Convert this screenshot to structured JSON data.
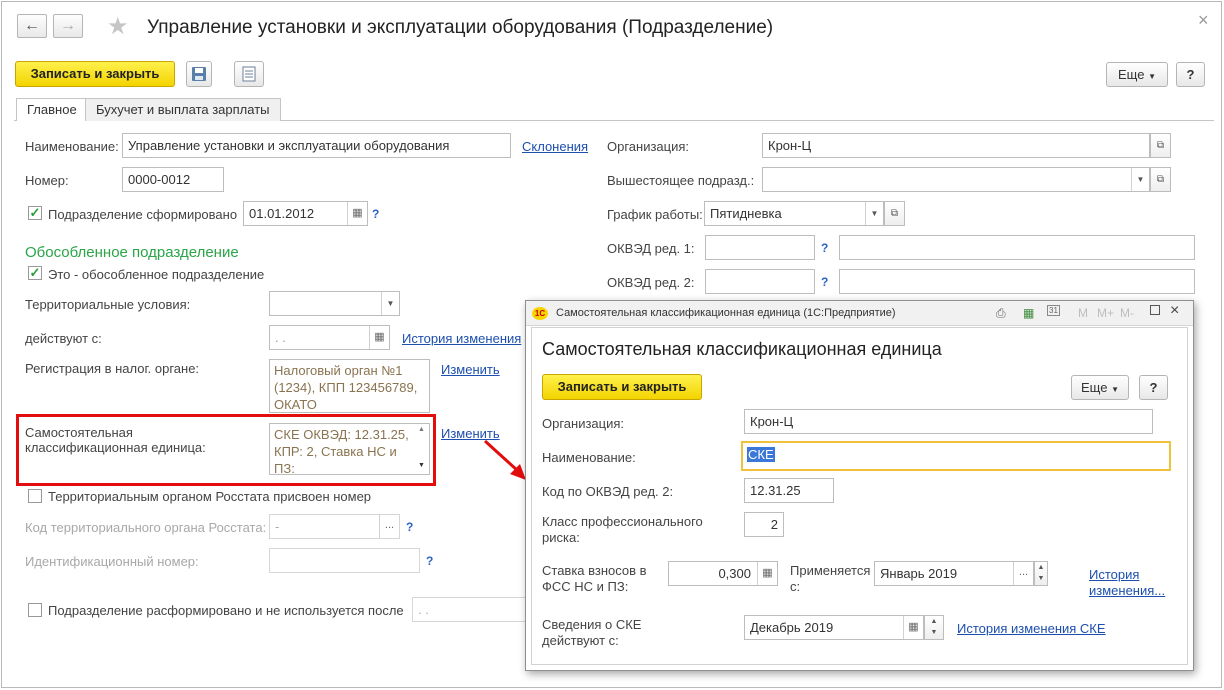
{
  "window": {
    "title": "Управление установки и эксплуатации оборудования (Подразделение)",
    "back_icon": "←",
    "forward_icon": "→",
    "star_icon": "★",
    "close_icon": "×"
  },
  "toolbar": {
    "save_close": "Записать и закрыть",
    "more": "Еще",
    "help": "?"
  },
  "tabs": [
    "Главное",
    "Бухучет и выплата зарплаты"
  ],
  "form": {
    "name_label": "Наименование:",
    "name_value": "Управление установки и эксплуатации оборудования",
    "declensions_link": "Склонения",
    "number_label": "Номер:",
    "number_value": "0000-0012",
    "formed_label": "Подразделение сформировано",
    "formed_date": "01.01.2012",
    "org_label": "Организация:",
    "org_value": "Крон-Ц",
    "parent_label": "Вышестоящее подразд.:",
    "parent_value": "",
    "schedule_label": "График работы:",
    "schedule_value": "Пятидневка",
    "okved1_label": "ОКВЭД ред. 1:",
    "okved2_label": "ОКВЭД ред. 2:",
    "separate_heading": "Обособленное подразделение",
    "separate_checkbox": "Это - обособленное подразделение",
    "territorial_label": "Территориальные условия:",
    "valid_from_label": "действуют с:",
    "valid_from_value": " .  .",
    "history_link": "История изменения",
    "tax_label": "Регистрация в налог. органе:",
    "tax_value": "Налоговый орган №1 (1234), КПП 123456789, ОКАТО",
    "change_link": "Изменить",
    "ske_label_1": "Самостоятельная",
    "ske_label_2": "классификационная единица:",
    "ske_value": "СКЕ ОКВЭД: 12.31.25, КПР: 2, Ставка НС и ПЗ:",
    "change_link_2": "Изменить",
    "rosstat_checkbox": "Территориальным органом Росстата присвоен номер",
    "rosstat_code_label": "Код территориального органа Росстата:",
    "rosstat_code_value": "-",
    "id_number_label": "Идентификационный номер:",
    "disbanded_checkbox": "Подразделение расформировано и не используется после",
    "disbanded_date": " .  ."
  },
  "dialog": {
    "window_title": "Самостоятельная классификационная единица  (1С:Предприятие)",
    "heading": "Самостоятельная классификационная единица",
    "save_close": "Записать и закрыть",
    "more": "Еще",
    "help": "?",
    "org_label": "Организация:",
    "org_value": "Крон-Ц",
    "name_label": "Наименование:",
    "name_value": "СКЕ",
    "okved_label": "Код по ОКВЭД ред. 2:",
    "okved_value": "12.31.25",
    "class_label_1": "Класс профессионального",
    "class_label_2": "риска:",
    "class_value": "2",
    "rate_label_1": "Ставка взносов в",
    "rate_label_2": "ФСС НС и ПЗ:",
    "rate_value": "0,300",
    "applies_label_1": "Применяется",
    "applies_label_2": "с:",
    "applies_value": "Январь 2019",
    "history_link_1": "История",
    "history_link_2": "изменения...",
    "info_label_1": "Сведения о СКЕ",
    "info_label_2": "действуют с:",
    "info_value": "Декабрь 2019",
    "history_ske_link": "История изменения СКЕ",
    "tb_m": "M",
    "tb_mplus": "M+",
    "tb_mminus": "M-"
  },
  "colors": {
    "accent_yellow": "#f7dc00",
    "highlight_red": "#e30d0d",
    "green_heading": "#2aa548",
    "link_blue": "#1c4fae",
    "focus_border": "#f0c23c"
  }
}
